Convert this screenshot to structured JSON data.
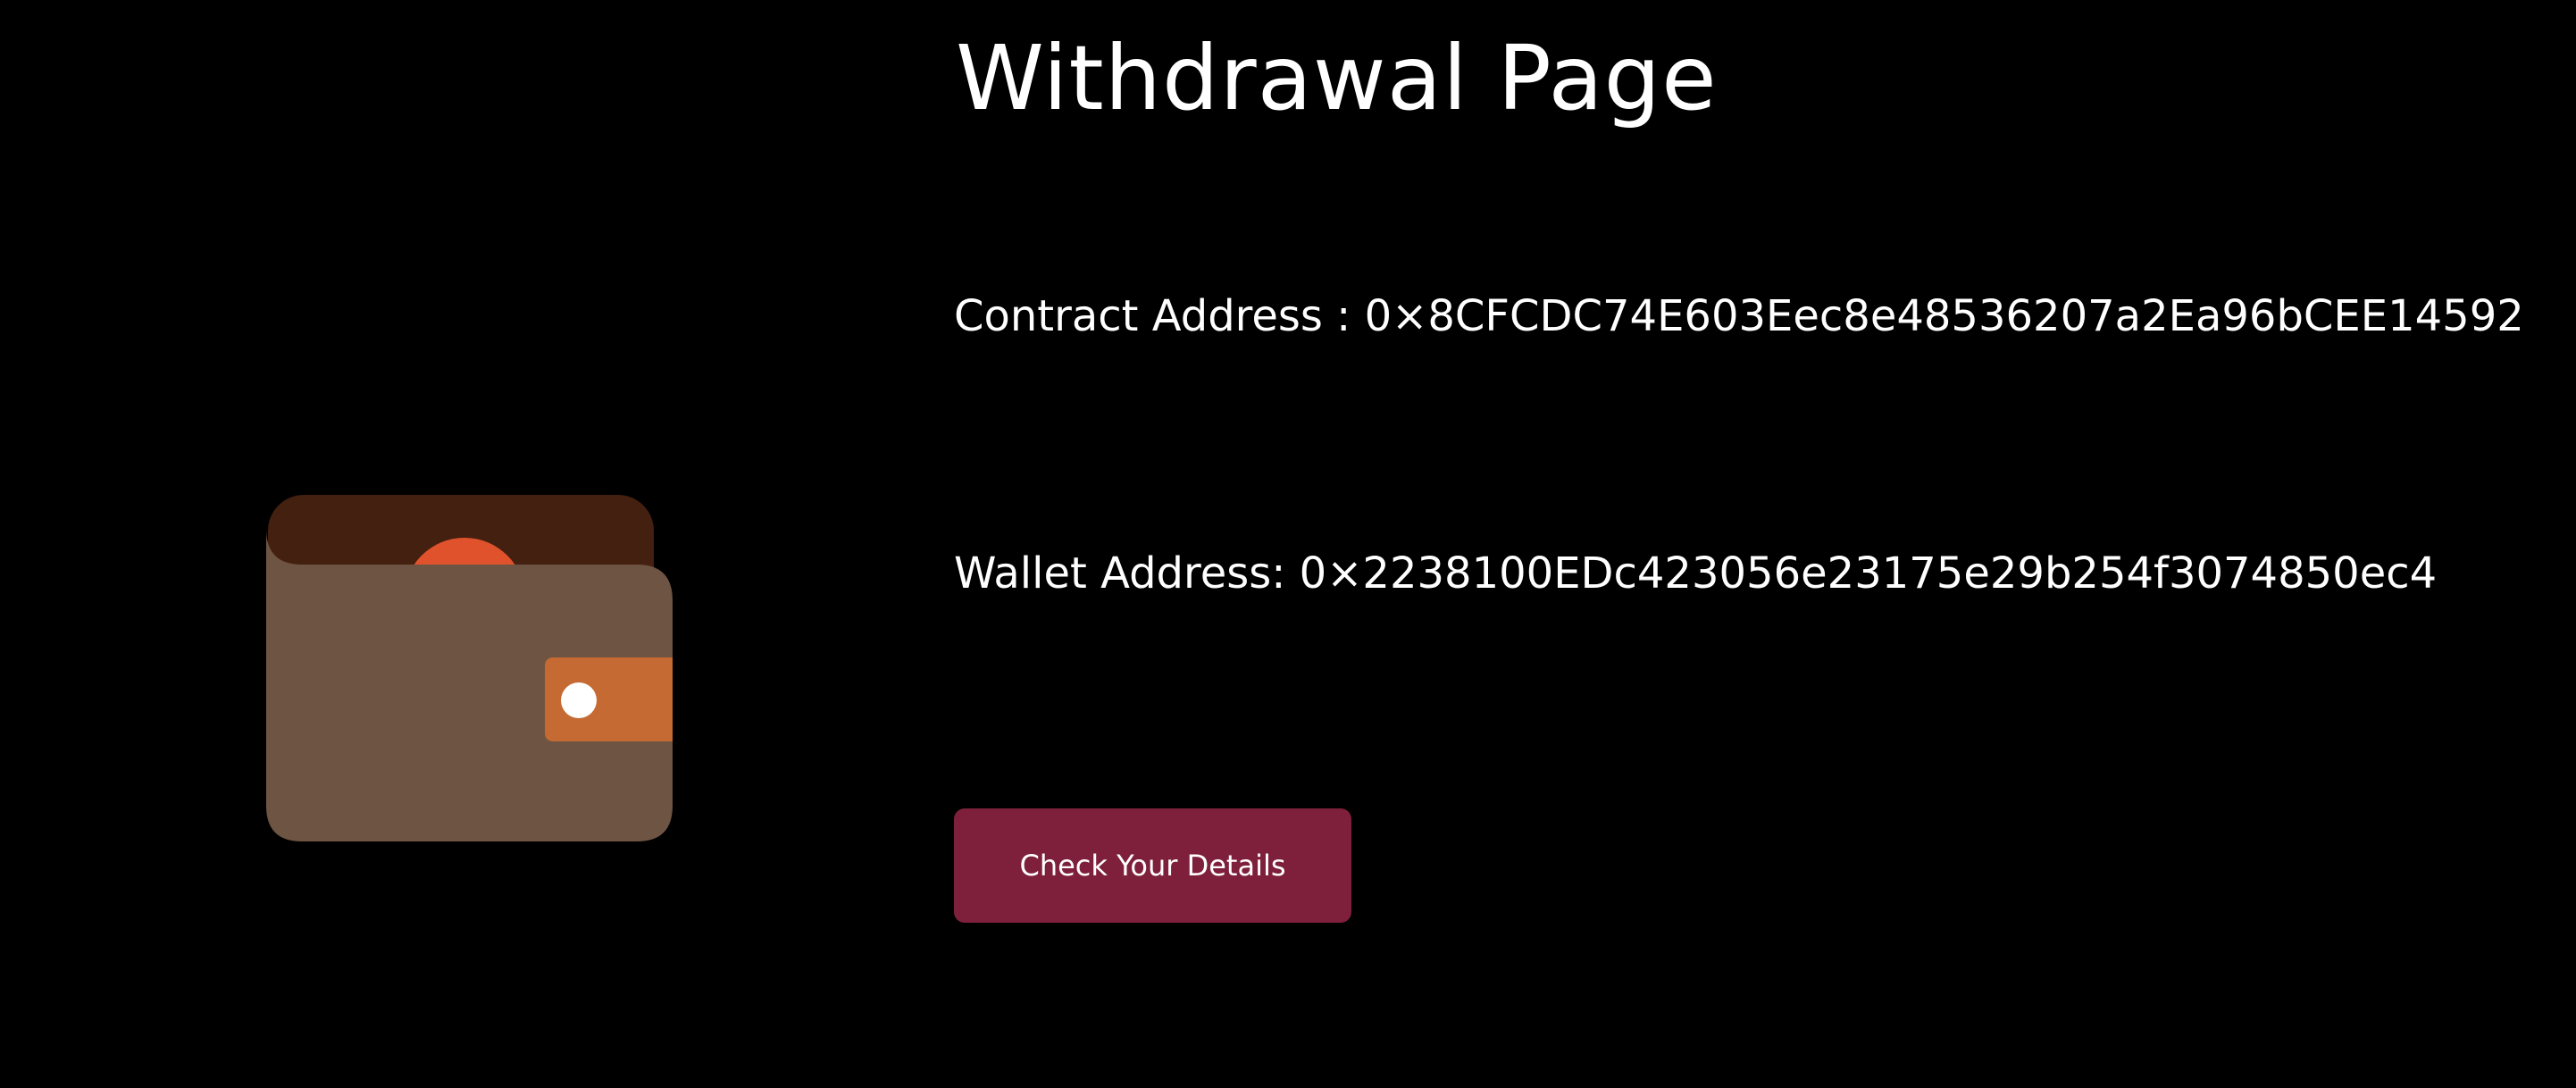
{
  "page": {
    "title": "Withdrawal Page"
  },
  "contract": {
    "label": "Contract Address : ",
    "value": "0×8CFCDC74E603Eec8e48536207a2Ea96bCEE14592"
  },
  "wallet": {
    "label": "Wallet Address: ",
    "value": "0×2238100EDc423056e23175e29b254f3074850ec4"
  },
  "actions": {
    "check_label": "Check Your Details"
  },
  "illustration": {
    "icon": "wallet-icon",
    "colors": {
      "back": "#432010",
      "coin": "#e0522c",
      "front": "#6e5442",
      "clasp": "#c46a32",
      "button": "#ffffff"
    }
  },
  "theme": {
    "background": "#000000",
    "text": "#ffffff",
    "accent": "#7e1f3b"
  }
}
